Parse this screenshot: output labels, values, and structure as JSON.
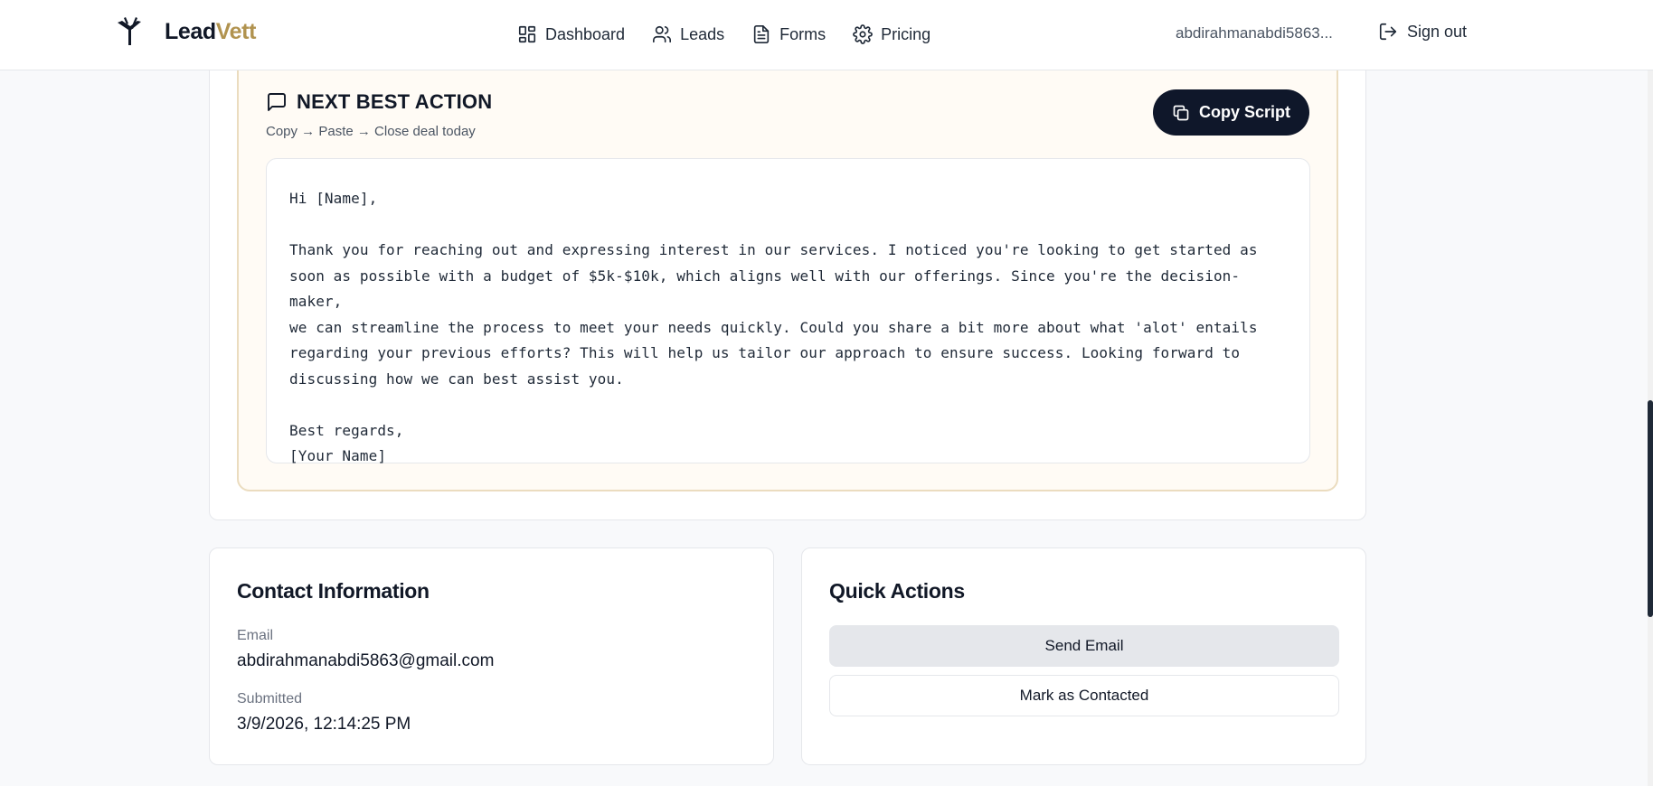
{
  "brand": {
    "lead": "Lead",
    "vett": "Vett",
    "icon": "funnel-logo-icon"
  },
  "nav": {
    "items": [
      {
        "label": "Dashboard",
        "icon": "dashboard-grid-icon"
      },
      {
        "label": "Leads",
        "icon": "users-icon"
      },
      {
        "label": "Forms",
        "icon": "document-icon"
      },
      {
        "label": "Pricing",
        "icon": "gear-icon"
      }
    ],
    "user_email": "abdirahmanabdi5863...",
    "signout_label": "Sign out"
  },
  "next_best_action": {
    "title": "NEXT BEST ACTION",
    "subtitle": "Copy → Paste → Close deal today",
    "copy_button_label": "Copy Script",
    "script": "Hi [Name],\n\nThank you for reaching out and expressing interest in our services. I noticed you're looking to get started as\nsoon as possible with a budget of $5k-$10k, which aligns well with our offerings. Since you're the decision-maker,\nwe can streamline the process to meet your needs quickly. Could you share a bit more about what 'alot' entails\nregarding your previous efforts? This will help us tailor our approach to ensure success. Looking forward to\ndiscussing how we can best assist you.\n\nBest regards,\n[Your Name]"
  },
  "contact": {
    "title": "Contact Information",
    "email_label": "Email",
    "email_value": "abdirahmanabdi5863@gmail.com",
    "submitted_label": "Submitted",
    "submitted_value": "3/9/2026, 12:14:25 PM"
  },
  "quick_actions": {
    "title": "Quick Actions",
    "send_email_label": "Send Email",
    "mark_contacted_label": "Mark as Contacted"
  },
  "colors": {
    "brand_gold": "#b1934f",
    "panel_bg": "#fffbf5",
    "panel_border": "#ebdcbf",
    "primary_dark": "#0f172a"
  }
}
